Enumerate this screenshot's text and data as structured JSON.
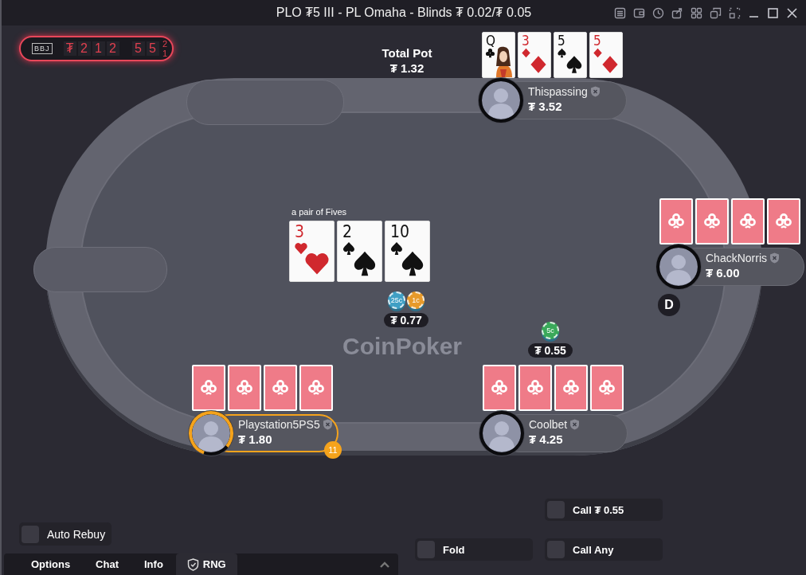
{
  "window": {
    "title": "PLO ₮5 III - PL Omaha - Blinds ₮ 0.02/₮ 0.05"
  },
  "jackpot_counter": {
    "label": "BBJ",
    "digits": [
      "₮",
      "2",
      "1",
      "2",
      "5",
      "5"
    ],
    "rolling_digits": [
      "2",
      "1"
    ]
  },
  "pot": {
    "label": "Total Pot",
    "amount": "₮ 1.32"
  },
  "hand_description": "a pair of Fives",
  "board": [
    {
      "rank": "3",
      "kind": "hearts"
    },
    {
      "rank": "2",
      "kind": "spades"
    },
    {
      "rank": "10",
      "kind": "spades"
    }
  ],
  "pot_bet": {
    "chips": [
      {
        "label": "25c",
        "color": "#3f9fc4"
      },
      {
        "label": "1c",
        "color": "#e79a2a"
      }
    ],
    "amount": "₮ 0.77"
  },
  "table_logo": "CoinPoker",
  "players": [
    {
      "name": "Thispassing",
      "stack": "₮ 3.52",
      "active": false,
      "cards": [
        {
          "kind": "clubs",
          "rank": "Q",
          "picture": true
        },
        {
          "kind": "diamonds",
          "rank": "3",
          "picture": false
        },
        {
          "kind": "spades",
          "rank": "5",
          "picture": false
        },
        {
          "kind": "diamonds",
          "rank": "5",
          "picture": false
        }
      ]
    },
    {
      "name": "ChackNorris",
      "stack": "₮ 6.00",
      "active": false,
      "dealer_label": "D",
      "cards": [
        {
          "kind": "back"
        },
        {
          "kind": "back"
        },
        {
          "kind": "back"
        },
        {
          "kind": "back"
        }
      ]
    },
    {
      "name": "Coolbet",
      "stack": "₮ 4.25",
      "active": false,
      "cards": [
        {
          "kind": "back"
        },
        {
          "kind": "back"
        },
        {
          "kind": "back"
        },
        {
          "kind": "back"
        }
      ],
      "bet": {
        "chips": [
          {
            "label": "5c",
            "color": "#3aa85a"
          }
        ],
        "amount": "₮ 0.55"
      }
    },
    {
      "name": "Playstation5PS5",
      "stack": "₮ 1.80",
      "active": true,
      "timer": "11",
      "cards": [
        {
          "kind": "back"
        },
        {
          "kind": "back"
        },
        {
          "kind": "back"
        },
        {
          "kind": "back"
        }
      ]
    }
  ],
  "auto_rebuy": {
    "label": "Auto Rebuy",
    "checked": false
  },
  "actions": [
    {
      "label": "Call ₮ 0.55",
      "checked": false
    },
    {
      "label": "Fold",
      "checked": false
    },
    {
      "label": "Call Any",
      "checked": false
    }
  ],
  "tabs": [
    {
      "label": "Options",
      "selected": false
    },
    {
      "label": "Chat",
      "selected": false
    },
    {
      "label": "Info",
      "selected": false
    },
    {
      "label": "RNG",
      "selected": true
    }
  ]
}
